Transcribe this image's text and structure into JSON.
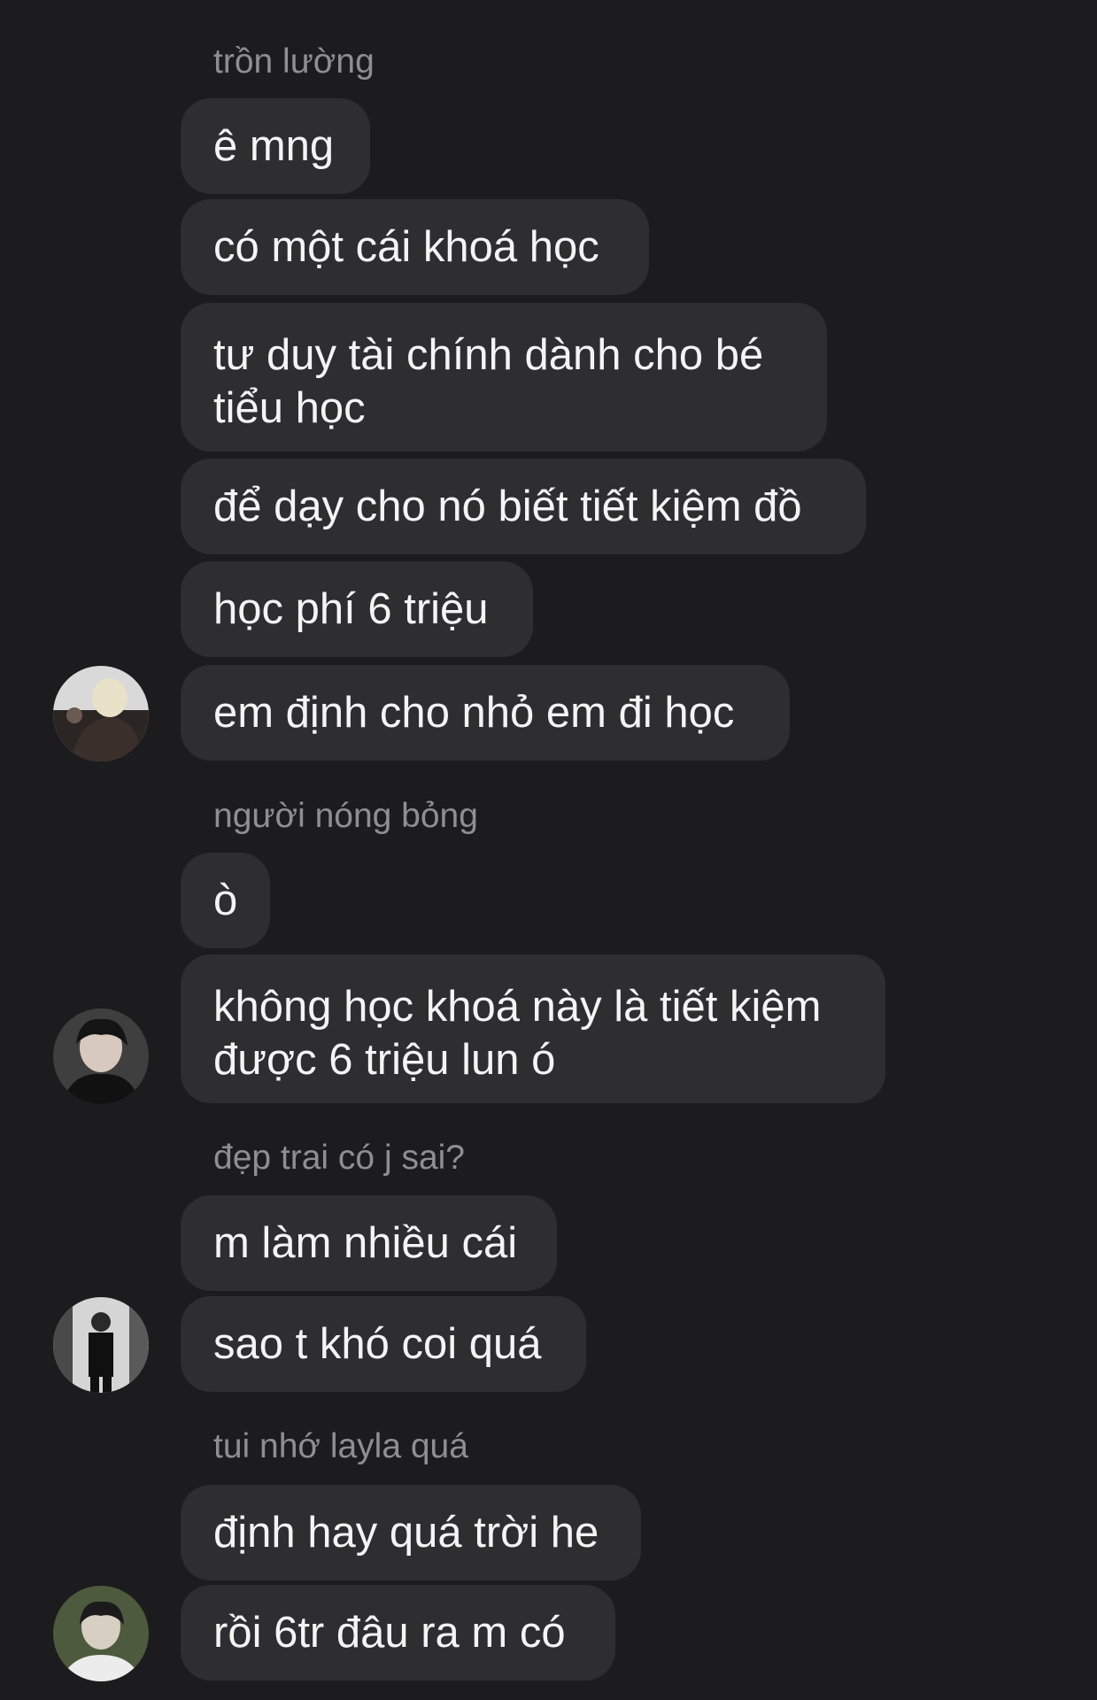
{
  "groups": [
    {
      "sender": "trồn lường",
      "messages": [
        "ê mng",
        "có một cái khoá học",
        "tư duy tài chính dành cho bé tiểu học",
        "để dạy cho nó biết tiết kiệm đồ",
        "học phí 6 triệu",
        "em định cho nhỏ em đi học"
      ]
    },
    {
      "sender": "người nóng bỏng",
      "messages": [
        "ò",
        "không học khoá này là tiết kiệm được 6 triệu lun ó"
      ]
    },
    {
      "sender": "đẹp trai có j sai?",
      "messages": [
        "m làm nhiều cái",
        "sao t khó coi quá"
      ]
    },
    {
      "sender": "tui nhớ layla quá",
      "messages": [
        "định hay quá trời he",
        "rồi 6tr đâu ra m có"
      ]
    }
  ]
}
